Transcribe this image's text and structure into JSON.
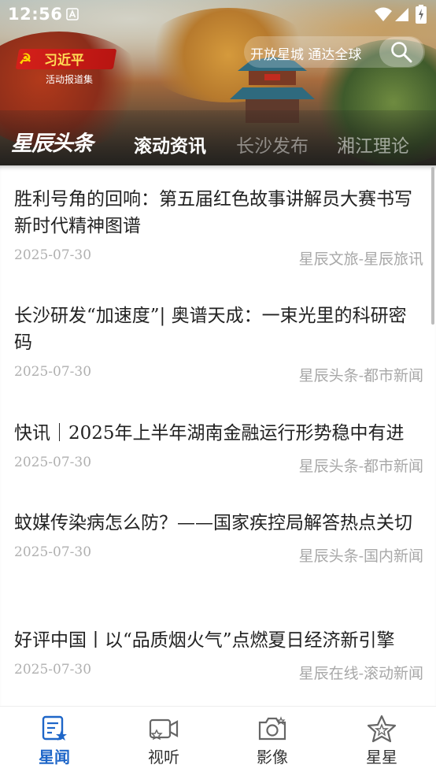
{
  "status_bar": {
    "time": "12:56"
  },
  "header": {
    "logo_title": "习近平",
    "logo_subtitle": "活动报道集",
    "search_placeholder": "开放星城 通达全球"
  },
  "tabs": [
    {
      "label": "星辰头条",
      "state": "brand"
    },
    {
      "label": "滚动资讯",
      "state": "active"
    },
    {
      "label": "长沙发布",
      "state": "inactive"
    },
    {
      "label": "湘江理论",
      "state": "inactive"
    }
  ],
  "news": [
    {
      "title": "胜利号角的回响：第五届红色故事讲解员大赛书写新时代精神图谱",
      "date": "2025-07-30",
      "source": "星辰文旅-星辰旅讯"
    },
    {
      "title": "长沙研发“加速度”| 奥谱天成：一束光里的科研密码",
      "date": "2025-07-30",
      "source": "星辰头条-都市新闻"
    },
    {
      "title": "快讯｜2025年上半年湖南金融运行形势稳中有进",
      "date": "2025-07-30",
      "source": "星辰头条-都市新闻"
    },
    {
      "title": "蚊媒传染病怎么防？——国家疾控局解答热点关切",
      "date": "2025-07-30",
      "source": "星辰头条-国内新闻"
    },
    {
      "title": "好评中国丨以“品质烟火气”点燃夏日经济新引擎",
      "date": "2025-07-30",
      "source": "星辰在线-滚动新闻"
    }
  ],
  "bottom_nav": [
    {
      "label": "星闻",
      "icon": "news-star-icon",
      "active": true
    },
    {
      "label": "视听",
      "icon": "video-camera-icon",
      "active": false
    },
    {
      "label": "影像",
      "icon": "photo-camera-icon",
      "active": false
    },
    {
      "label": "星星",
      "icon": "star-badge-icon",
      "active": false
    }
  ],
  "colors": {
    "accent": "#1e66c8",
    "date": "#b0b0b0",
    "title": "#222222"
  }
}
